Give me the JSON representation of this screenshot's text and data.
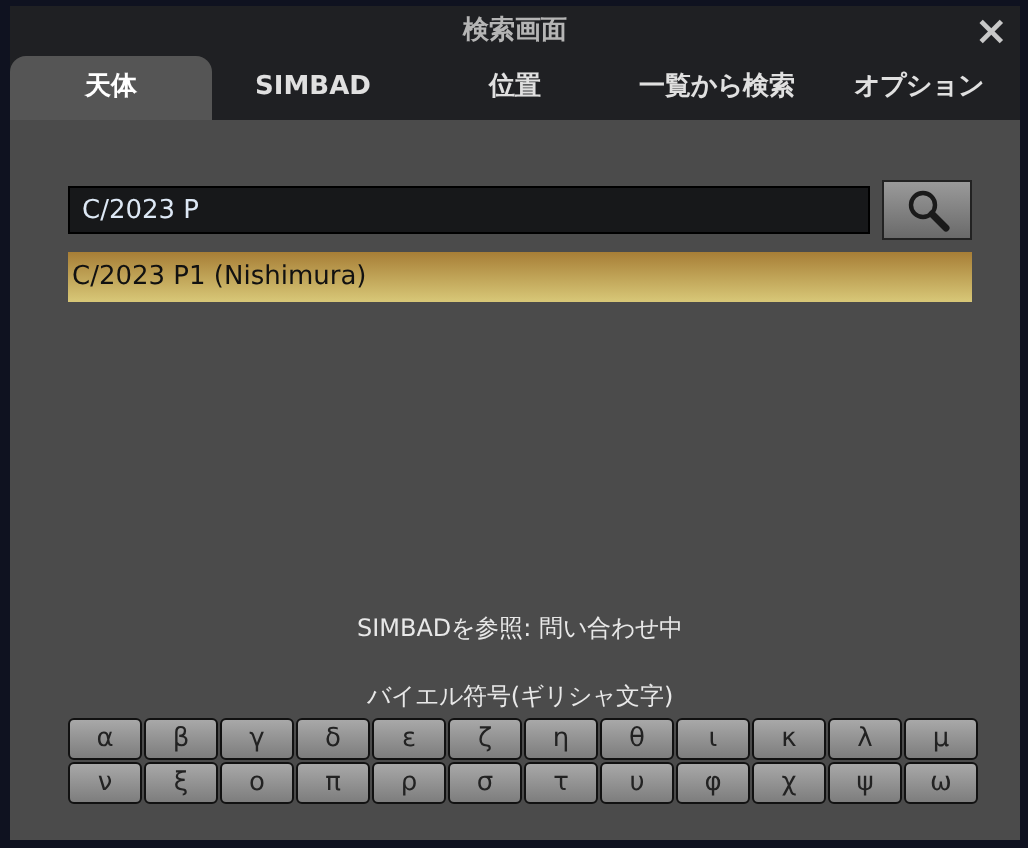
{
  "window": {
    "title": "検索画面",
    "close": "×"
  },
  "tabs": [
    {
      "label": "天体",
      "selected": true
    },
    {
      "label": "SIMBAD",
      "selected": false
    },
    {
      "label": "位置",
      "selected": false
    },
    {
      "label": "一覧から検索",
      "selected": false
    },
    {
      "label": "オプション",
      "selected": false
    }
  ],
  "search": {
    "value": "C/2023 P"
  },
  "results": [
    {
      "label": "C/2023 P1 (Nishimura)",
      "selected": true
    }
  ],
  "simbad_status": "SIMBADを参照: 問い合わせ中",
  "greek": {
    "title": "バイエル符号(ギリシャ文字)",
    "letters": [
      "α",
      "β",
      "γ",
      "δ",
      "ε",
      "ζ",
      "η",
      "θ",
      "ι",
      "κ",
      "λ",
      "μ",
      "ν",
      "ξ",
      "ο",
      "π",
      "ρ",
      "σ",
      "τ",
      "υ",
      "φ",
      "χ",
      "ψ",
      "ω"
    ]
  }
}
